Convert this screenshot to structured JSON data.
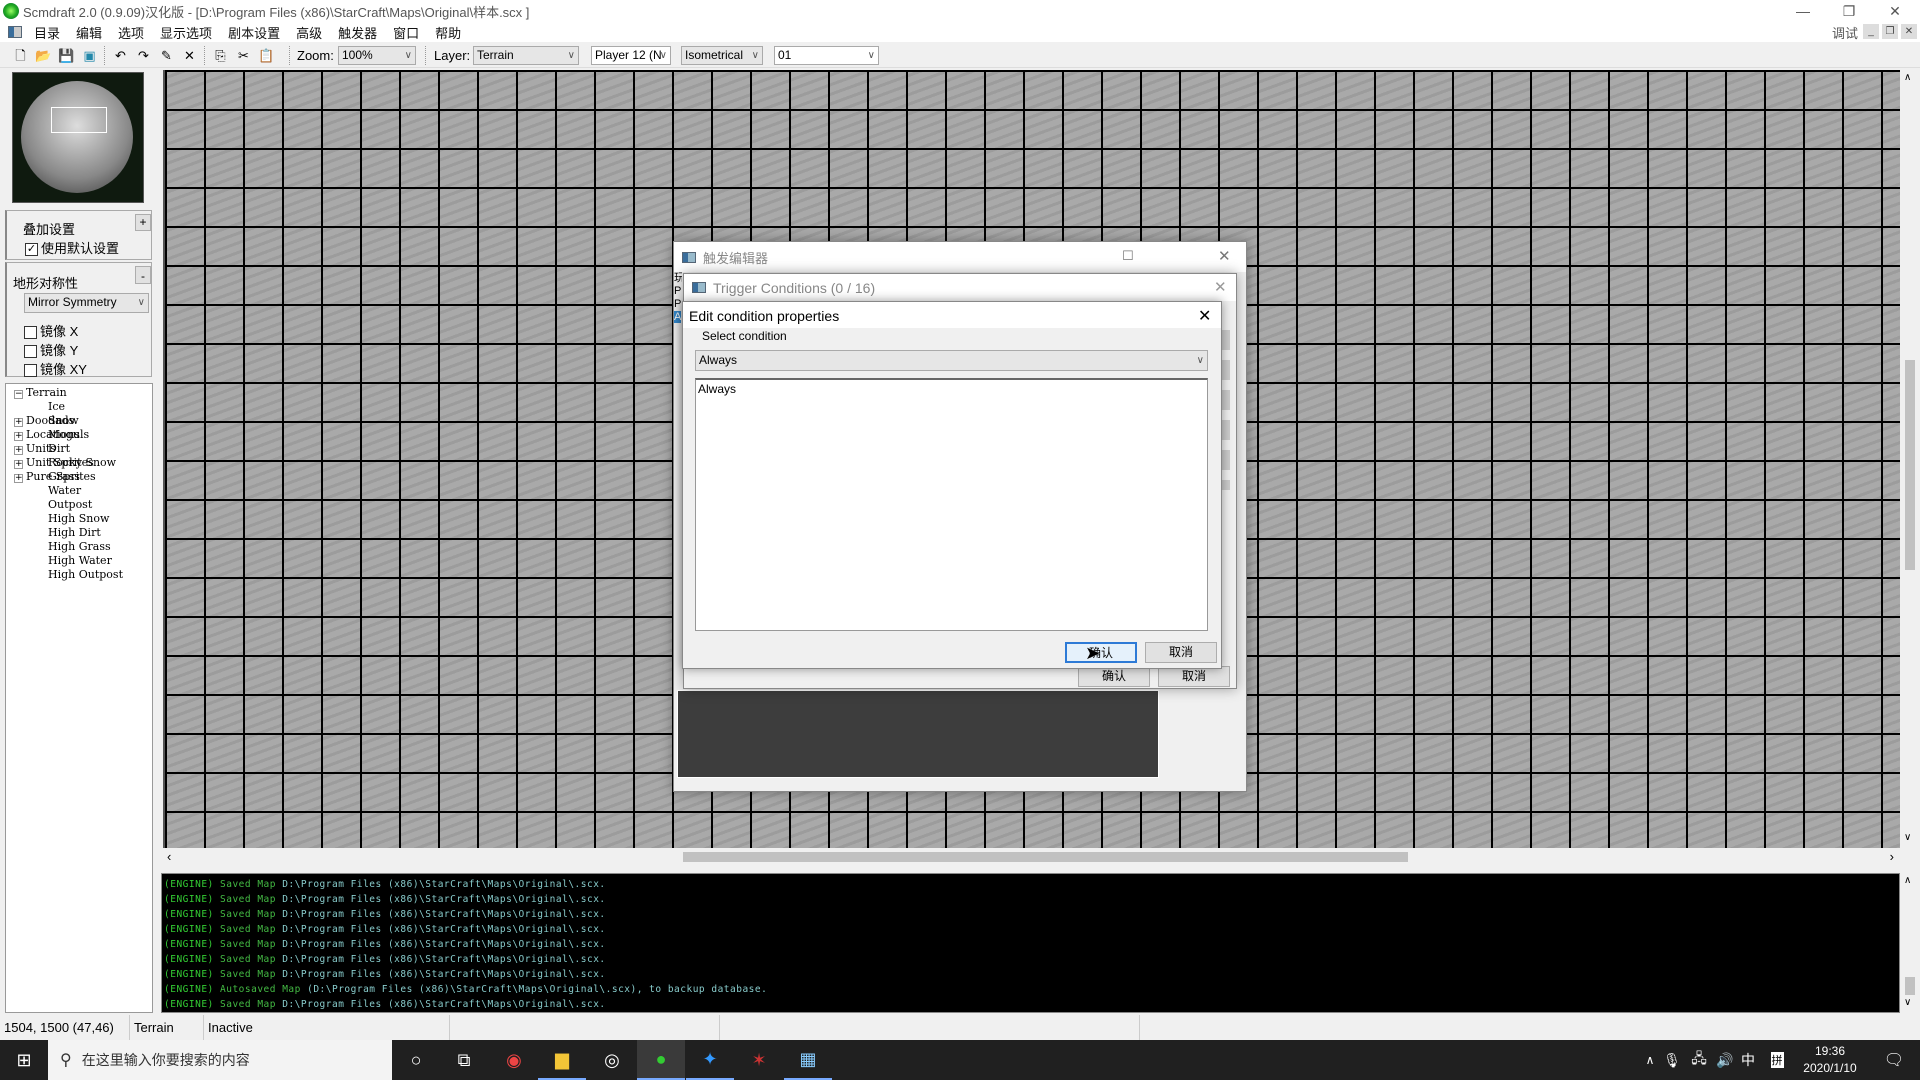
{
  "window": {
    "title": "Scmdraft 2.0 (0.9.09)汉化版 - [D:\\Program Files (x86)\\StarCraft\\Maps\\Original\\样本.scx ]",
    "debug_label": "调试"
  },
  "menu": [
    "目录",
    "编辑",
    "选项",
    "显示选项",
    "剧本设置",
    "高级",
    "触发器",
    "窗口",
    "帮助"
  ],
  "toolbar": {
    "zoom_label": "Zoom:",
    "zoom_value": "100%",
    "layer_label": "Layer:",
    "layer_value": "Terrain",
    "player_value": "Player 12 (N",
    "view_value": "Isometrical",
    "brush_value": "01"
  },
  "left_panel": {
    "overlay_title": "叠加设置",
    "overlay_toggle": "+",
    "use_default": "使用默认设置",
    "use_default_checked": true,
    "symmetry_title": "地形对称性",
    "symmetry_toggle": "-",
    "symmetry_value": "Mirror Symmetry",
    "mirror_x": "镜像 X",
    "mirror_y": "镜像 Y",
    "mirror_xy": "镜像 XY"
  },
  "tree": {
    "root": "Terrain",
    "children": [
      "Ice",
      "Snow",
      "Moguls",
      "Dirt",
      "Rocky Snow",
      "Grass",
      "Water",
      "Outpost",
      "High Snow",
      "High Dirt",
      "High Grass",
      "High Water",
      "High Outpost"
    ],
    "others": [
      "Doodads",
      "Locations",
      "Units",
      "Unit Sprites",
      "Pure Sprites"
    ]
  },
  "trigger_editor": {
    "title": "触发编辑器",
    "ok": "确认",
    "cancel": "取消"
  },
  "trigger_conditions": {
    "title": "Trigger Conditions (0 / 16)"
  },
  "edit_condition": {
    "title": "Edit condition properties",
    "select_label": "Select condition",
    "select_value": "Always",
    "description": "Always",
    "ok": "确认",
    "cancel": "取消"
  },
  "log": [
    {
      "tag": "(ENGINE)",
      "action": "Saved Map",
      "rest": "D:\\Program Files (x86)\\StarCraft\\Maps\\Original\\.scx."
    },
    {
      "tag": "(ENGINE)",
      "action": "Saved Map",
      "rest": "D:\\Program Files (x86)\\StarCraft\\Maps\\Original\\.scx."
    },
    {
      "tag": "(ENGINE)",
      "action": "Saved Map",
      "rest": "D:\\Program Files (x86)\\StarCraft\\Maps\\Original\\.scx."
    },
    {
      "tag": "(ENGINE)",
      "action": "Saved Map",
      "rest": "D:\\Program Files (x86)\\StarCraft\\Maps\\Original\\.scx."
    },
    {
      "tag": "(ENGINE)",
      "action": "Saved Map",
      "rest": "D:\\Program Files (x86)\\StarCraft\\Maps\\Original\\.scx."
    },
    {
      "tag": "(ENGINE)",
      "action": "Saved Map",
      "rest": "D:\\Program Files (x86)\\StarCraft\\Maps\\Original\\.scx."
    },
    {
      "tag": "(ENGINE)",
      "action": "Saved Map",
      "rest": "D:\\Program Files (x86)\\StarCraft\\Maps\\Original\\.scx."
    },
    {
      "tag": "(ENGINE)",
      "action": "Autosaved Map",
      "rest": "(D:\\Program Files (x86)\\StarCraft\\Maps\\Original\\.scx), to backup database."
    },
    {
      "tag": "(ENGINE)",
      "action": "Saved Map",
      "rest": "D:\\Program Files (x86)\\StarCraft\\Maps\\Original\\.scx."
    }
  ],
  "status": {
    "coords": "1504, 1500 (47,46)",
    "layer": "Terrain",
    "state": "Inactive"
  },
  "taskbar": {
    "search_placeholder": "在这里输入你要搜索的内容",
    "time": "19:36",
    "date": "2020/1/10",
    "ime": "中",
    "ime_mode": "拼"
  }
}
